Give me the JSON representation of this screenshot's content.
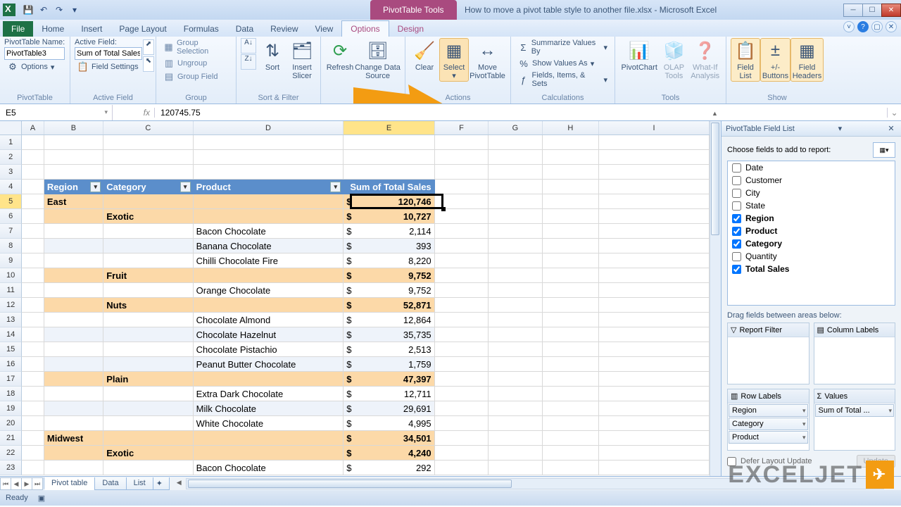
{
  "titlebar": {
    "pivottools": "PivotTable Tools",
    "document": "How to move a pivot table style to another file.xlsx - Microsoft Excel"
  },
  "tabs": [
    "File",
    "Home",
    "Insert",
    "Page Layout",
    "Formulas",
    "Data",
    "Review",
    "View",
    "Options",
    "Design"
  ],
  "active_tab": "Options",
  "ribbon": {
    "pt_name_lbl": "PivotTable Name:",
    "pt_name_val": "PivotTable3",
    "options_lbl": "Options",
    "pt_group": "PivotTable",
    "active_field_lbl": "Active Field:",
    "active_field_val": "Sum of Total Sales",
    "field_settings": "Field Settings",
    "active_field_group": "Active Field",
    "group_sel": "Group Selection",
    "ungroup": "Ungroup",
    "group_field": "Group Field",
    "group_group": "Group",
    "sort": "Sort",
    "insert_slicer": "Insert\nSlicer",
    "sortfilter_group": "Sort & Filter",
    "refresh": "Refresh",
    "change_src": "Change Data\nSource",
    "data_group": "Data",
    "clear": "Clear",
    "select": "Select",
    "move": "Move\nPivotTable",
    "actions_group": "Actions",
    "summarize": "Summarize Values By",
    "show_as": "Show Values As",
    "fields": "Fields, Items, & Sets",
    "calc_group": "Calculations",
    "pivotchart": "PivotChart",
    "olap": "OLAP\nTools",
    "whatif": "What-If\nAnalysis",
    "tools_group": "Tools",
    "field_list": "Field\nList",
    "buttons": "+/-\nButtons",
    "field_headers": "Field\nHeaders",
    "show_group": "Show"
  },
  "namebox": "E5",
  "formula": "120745.75",
  "columns": [
    "A",
    "B",
    "C",
    "D",
    "E",
    "F",
    "G",
    "H",
    "I"
  ],
  "pivot": {
    "headers": [
      "Region",
      "Category",
      "Product",
      "Sum of Total Sales"
    ],
    "rows": [
      {
        "r": 5,
        "lvl": 0,
        "b": "East",
        "e_sym": "$",
        "e": "120,746",
        "bold": true
      },
      {
        "r": 6,
        "lvl": 1,
        "c": "Exotic",
        "e_sym": "$",
        "e": "10,727",
        "bold": true
      },
      {
        "r": 7,
        "lvl": 2,
        "d": "Bacon Chocolate",
        "e_sym": "$",
        "e": "2,114"
      },
      {
        "r": 8,
        "lvl": 2,
        "d": "Banana Chocolate",
        "e_sym": "$",
        "e": "393",
        "odd": true
      },
      {
        "r": 9,
        "lvl": 2,
        "d": "Chilli Chocolate Fire",
        "e_sym": "$",
        "e": "8,220"
      },
      {
        "r": 10,
        "lvl": 1,
        "c": "Fruit",
        "e_sym": "$",
        "e": "9,752",
        "bold": true
      },
      {
        "r": 11,
        "lvl": 2,
        "d": "Orange Chocolate",
        "e_sym": "$",
        "e": "9,752"
      },
      {
        "r": 12,
        "lvl": 1,
        "c": "Nuts",
        "e_sym": "$",
        "e": "52,871",
        "bold": true
      },
      {
        "r": 13,
        "lvl": 2,
        "d": "Chocolate Almond",
        "e_sym": "$",
        "e": "12,864"
      },
      {
        "r": 14,
        "lvl": 2,
        "d": "Chocolate Hazelnut",
        "e_sym": "$",
        "e": "35,735",
        "odd": true
      },
      {
        "r": 15,
        "lvl": 2,
        "d": "Chocolate Pistachio",
        "e_sym": "$",
        "e": "2,513"
      },
      {
        "r": 16,
        "lvl": 2,
        "d": "Peanut Butter Chocolate",
        "e_sym": "$",
        "e": "1,759",
        "odd": true
      },
      {
        "r": 17,
        "lvl": 1,
        "c": "Plain",
        "e_sym": "$",
        "e": "47,397",
        "bold": true
      },
      {
        "r": 18,
        "lvl": 2,
        "d": "Extra Dark Chocolate",
        "e_sym": "$",
        "e": "12,711"
      },
      {
        "r": 19,
        "lvl": 2,
        "d": "Milk Chocolate",
        "e_sym": "$",
        "e": "29,691",
        "odd": true
      },
      {
        "r": 20,
        "lvl": 2,
        "d": "White Chocolate",
        "e_sym": "$",
        "e": "4,995"
      },
      {
        "r": 21,
        "lvl": 0,
        "b": "Midwest",
        "e_sym": "$",
        "e": "34,501",
        "bold": true
      },
      {
        "r": 22,
        "lvl": 1,
        "c": "Exotic",
        "e_sym": "$",
        "e": "4,240",
        "bold": true
      },
      {
        "r": 23,
        "lvl": 2,
        "d": "Bacon Chocolate",
        "e_sym": "$",
        "e": "292"
      }
    ]
  },
  "fieldlist": {
    "title": "PivotTable Field List",
    "choose": "Choose fields to add to report:",
    "fields": [
      {
        "name": "Date",
        "checked": false
      },
      {
        "name": "Customer",
        "checked": false
      },
      {
        "name": "City",
        "checked": false
      },
      {
        "name": "State",
        "checked": false
      },
      {
        "name": "Region",
        "checked": true
      },
      {
        "name": "Product",
        "checked": true
      },
      {
        "name": "Category",
        "checked": true
      },
      {
        "name": "Quantity",
        "checked": false
      },
      {
        "name": "Total Sales",
        "checked": true
      }
    ],
    "dragnote": "Drag fields between areas below:",
    "area_rf": "Report Filter",
    "area_cl": "Column Labels",
    "area_rl": "Row Labels",
    "area_v": "Values",
    "row_items": [
      "Region",
      "Category",
      "Product"
    ],
    "val_items": [
      "Sum of Total ..."
    ],
    "defer": "Defer Layout Update",
    "update": "Update"
  },
  "sheets": [
    "Pivot table",
    "Data",
    "List"
  ],
  "active_sheet": "Pivot table",
  "status": "Ready",
  "watermark": "EXCELJET"
}
